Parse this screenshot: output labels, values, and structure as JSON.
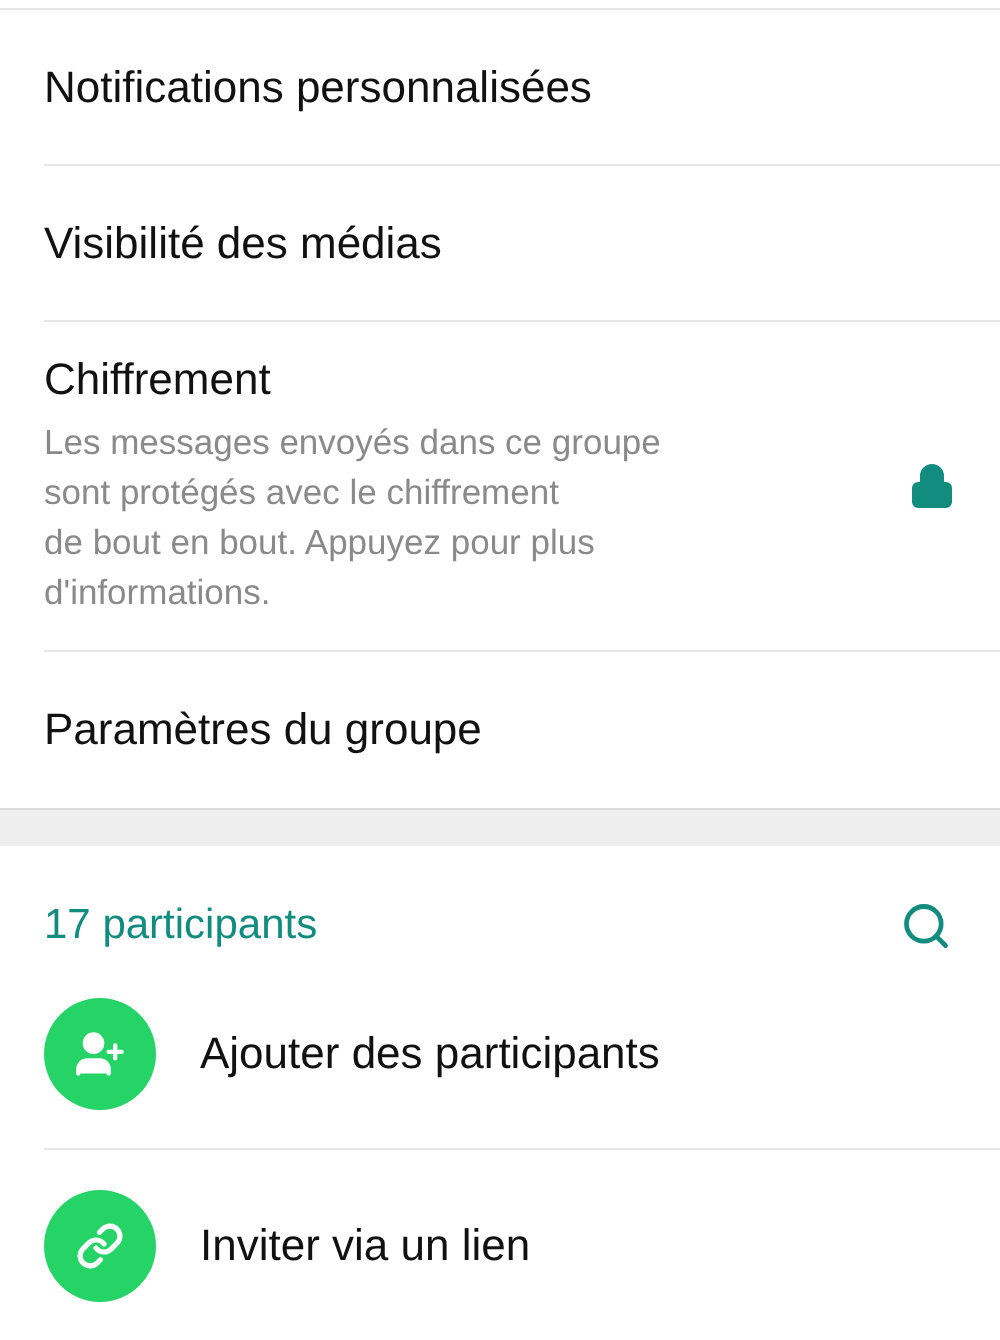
{
  "settings": [
    {
      "kind": "plain",
      "title": "Notifications personnalisées"
    },
    {
      "kind": "plain",
      "title": "Visibilité des médias"
    },
    {
      "kind": "locked",
      "title": "Chiffrement",
      "description": "Les messages envoyés dans ce groupe\nsont protégés avec le chiffrement\nde bout en bout. Appuyez pour plus\nd'informations."
    },
    {
      "kind": "plain",
      "title": "Paramètres du groupe"
    }
  ],
  "participants": {
    "heading": "17 participants",
    "actions": [
      {
        "kind": "add-person",
        "label": "Ajouter des participants"
      },
      {
        "kind": "link",
        "label": "Inviter via un lien"
      }
    ]
  }
}
